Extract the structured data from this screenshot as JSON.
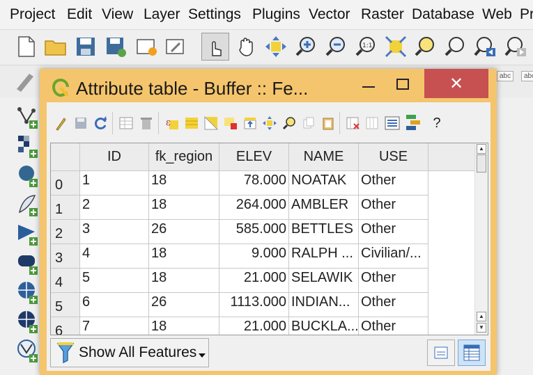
{
  "menubar": {
    "items": [
      "Project",
      "Edit",
      "View",
      "Layer",
      "Settings",
      "Plugins",
      "Vector",
      "Raster",
      "Database",
      "Web",
      "Pr"
    ]
  },
  "toolbar": {
    "icons": [
      "new-project-icon",
      "open-project-icon",
      "save-project-icon",
      "save-as-icon",
      "new-print-composer-icon",
      "composer-manager-icon",
      "touch-zoom-pan-icon",
      "pan-map-icon",
      "pan-to-selection-icon",
      "zoom-in-icon",
      "zoom-out-icon",
      "zoom-actual-size-icon",
      "zoom-full-icon",
      "zoom-to-selection-icon",
      "zoom-to-layer-icon",
      "zoom-last-icon",
      "zoom-next-icon"
    ]
  },
  "dialog": {
    "title": "Attribute table - Buffer :: Fe...",
    "close_glyph": "✕",
    "toolbar_icons": [
      "toggle-editing-icon",
      "save-edits-icon",
      "reload-icon",
      "add-feature-icon",
      "delete-feature-icon",
      "select-by-expression-icon",
      "select-all-icon",
      "invert-selection-icon",
      "deselect-all-icon",
      "move-selection-to-top-icon",
      "pan-to-selected-icon",
      "zoom-to-selected-icon",
      "copy-rows-icon",
      "paste-features-icon",
      "delete-column-icon",
      "new-column-icon",
      "field-calculator-icon",
      "conditional-formatting-icon",
      "help-icon"
    ],
    "help_label": "?",
    "table": {
      "columns": [
        "ID",
        "fk_region",
        "ELEV",
        "NAME",
        "USE"
      ],
      "rows": [
        {
          "row": "0",
          "ID": "1",
          "fk_region": "18",
          "ELEV": "78.000",
          "NAME": "NOATAK",
          "USE": "Other"
        },
        {
          "row": "1",
          "ID": "2",
          "fk_region": "18",
          "ELEV": "264.000",
          "NAME": "AMBLER",
          "USE": "Other"
        },
        {
          "row": "2",
          "ID": "3",
          "fk_region": "26",
          "ELEV": "585.000",
          "NAME": "BETTLES",
          "USE": "Other"
        },
        {
          "row": "3",
          "ID": "4",
          "fk_region": "18",
          "ELEV": "9.000",
          "NAME": "RALPH ...",
          "USE": "Civilian/..."
        },
        {
          "row": "4",
          "ID": "5",
          "fk_region": "18",
          "ELEV": "21.000",
          "NAME": "SELAWIK",
          "USE": "Other"
        },
        {
          "row": "5",
          "ID": "6",
          "fk_region": "26",
          "ELEV": "1113.000",
          "NAME": "INDIAN...",
          "USE": "Other"
        },
        {
          "row": "6",
          "ID": "7",
          "fk_region": "18",
          "ELEV": "21.000",
          "NAME": "BUCKLA...",
          "USE": "Other"
        }
      ]
    },
    "filter_button_label": "Show All Features",
    "accent_color": "#f5c56d",
    "close_color": "#c75050"
  },
  "sidebar": {
    "icons": [
      "add-vector-layer-icon",
      "add-raster-layer-icon",
      "add-postgis-layer-icon",
      "add-spatialite-layer-icon",
      "add-mssql-layer-icon",
      "add-oracle-layer-icon",
      "add-wms-layer-icon",
      "add-wcs-layer-icon",
      "add-wfs-layer-icon"
    ]
  }
}
